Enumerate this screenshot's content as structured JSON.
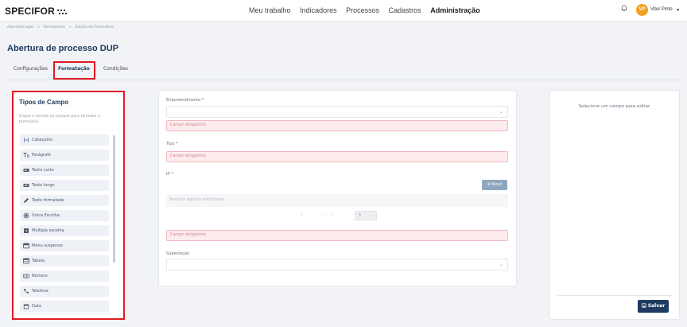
{
  "app": {
    "logo": "SPECIFOR"
  },
  "nav": {
    "items": [
      "Meu trabalho",
      "Indicadores",
      "Processos",
      "Cadastros",
      "Administração"
    ],
    "active": "Administração"
  },
  "user": {
    "initials": "VP",
    "name": "Vitor Pinto"
  },
  "breadcrumb": [
    "Administração",
    ">",
    "Formulários",
    ">",
    "Edição do Formulário"
  ],
  "page_title": "Abertura de processo DUP",
  "tabs": [
    "Configurações",
    "Formatação",
    "Condições"
  ],
  "tabs_active": "Formatação",
  "field_types": {
    "title": "Tipos de Campo",
    "description": "Clique e arraste os campos para formatar o formulário.",
    "items": [
      {
        "label": "Cabeçalho",
        "icon": "heading-icon"
      },
      {
        "label": "Parágrafo",
        "icon": "paragraph-icon"
      },
      {
        "label": "Texto curto",
        "icon": "short-text-icon"
      },
      {
        "label": "Texto longo",
        "icon": "long-text-icon"
      },
      {
        "label": "Texto formatado",
        "icon": "pencil-icon"
      },
      {
        "label": "Única Escolha",
        "icon": "radio-icon"
      },
      {
        "label": "Múltipla escolha",
        "icon": "checkbox-icon"
      },
      {
        "label": "Menu suspenso",
        "icon": "dropdown-icon"
      },
      {
        "label": "Tabela",
        "icon": "table-icon"
      },
      {
        "label": "Número",
        "icon": "number-icon"
      },
      {
        "label": "Telefone",
        "icon": "phone-icon"
      },
      {
        "label": "Data",
        "icon": "calendar-icon"
      }
    ]
  },
  "form": {
    "empreendimento_label": "Empreendimento *",
    "required_msg": "Campo obrigatório",
    "tipo_label": "Tipo *",
    "lt_label": "LT *",
    "novo_label": "⊕ Novo",
    "empty_msg": "Nenhum registro encontrado",
    "pager": [
      "«",
      "‹",
      "›",
      "»"
    ],
    "page_size": "5",
    "subestacao_label": "Subestação"
  },
  "editor": {
    "hint": "Selecione um campo para editar.",
    "save_label": "Salvar"
  },
  "colors": {
    "primary": "#1e3a5f",
    "highlight": "#e01b24",
    "error_bg": "#fdecee"
  }
}
